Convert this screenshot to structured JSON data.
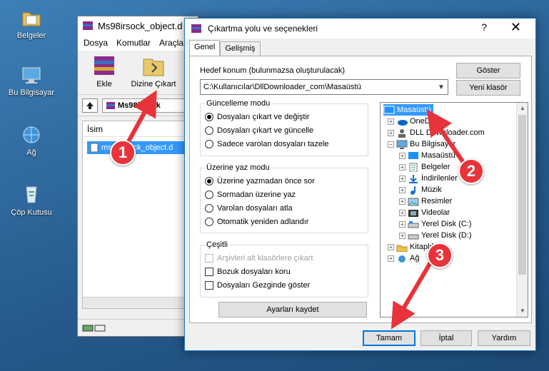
{
  "desktop": {
    "icons": [
      {
        "label": "Belgeler",
        "icon": "folder-documents-icon"
      },
      {
        "label": "Bu Bilgisayar",
        "icon": "computer-icon"
      },
      {
        "label": "Ağ",
        "icon": "network-icon"
      },
      {
        "label": "Çöp Kutusu",
        "icon": "recycle-bin-icon"
      }
    ]
  },
  "winrar": {
    "title": "Ms98irsock_object.d",
    "menu": [
      "Dosya",
      "Komutlar",
      "Araçla"
    ],
    "toolbar": {
      "add_label": "Ekle",
      "extract_label": "Dizine Çıkart"
    },
    "address": "Ms98irsock",
    "column_name": "İsim",
    "selected_file": "ms98irsock_object.d"
  },
  "dialog": {
    "title": "Çıkartma yolu ve seçenekleri",
    "help": "?",
    "close": "✕",
    "tabs": [
      "Genel",
      "Gelişmiş"
    ],
    "destination_label": "Hedef konum (bulunmazsa oluşturulacak)",
    "destination_value": "C:\\Kullanıcılar\\DllDownloader_com\\Masaüstü",
    "show_button": "Göster",
    "new_folder_button": "Yeni klasör",
    "update_mode": {
      "title": "Güncelleme modu",
      "options": [
        "Dosyaları çıkart ve değiştir",
        "Dosyaları çıkart ve güncelle",
        "Sadece varolan dosyaları tazele"
      ],
      "selected": 0
    },
    "overwrite_mode": {
      "title": "Üzerine yaz modu",
      "options": [
        "Üzerine yazmadan önce sor",
        "Sormadan üzerine yaz",
        "Varolan dosyaları atla",
        "Otomatik yeniden adlandır"
      ],
      "selected": 0
    },
    "misc": {
      "title": "Çeşitli",
      "options": [
        "Arşivleri alt klasörlere çıkart",
        "Bozuk dosyaları koru",
        "Dosyaları Gezginde göster"
      ]
    },
    "save_settings_button": "Ayarları kaydet",
    "tree": {
      "items": [
        {
          "label": "Masaüstü",
          "icon": "desktop-icon"
        },
        {
          "label": "OneDrive",
          "icon": "onedrive-icon"
        },
        {
          "label": "DLL Downloader.com",
          "icon": "user-icon"
        },
        {
          "label": "Bu Bilgisayar",
          "icon": "computer-icon"
        },
        {
          "label": "Masaüstü",
          "icon": "desktop-icon"
        },
        {
          "label": "Belgeler",
          "icon": "documents-icon"
        },
        {
          "label": "İndirilenler",
          "icon": "download-icon"
        },
        {
          "label": "Müzik",
          "icon": "music-icon"
        },
        {
          "label": "Resimler",
          "icon": "pictures-icon"
        },
        {
          "label": "Videolar",
          "icon": "videos-icon"
        },
        {
          "label": "Yerel Disk (C:)",
          "icon": "drive-icon"
        },
        {
          "label": "Yerel Disk (D:)",
          "icon": "drive-icon"
        },
        {
          "label": "Kitaplıklar",
          "icon": "libraries-icon"
        },
        {
          "label": "Ağ",
          "icon": "network-icon"
        }
      ]
    },
    "ok_button": "Tamam",
    "cancel_button": "İptal",
    "help_button": "Yardım"
  },
  "annotations": {
    "steps": [
      "1",
      "2",
      "3"
    ],
    "color": "#e8333a"
  }
}
